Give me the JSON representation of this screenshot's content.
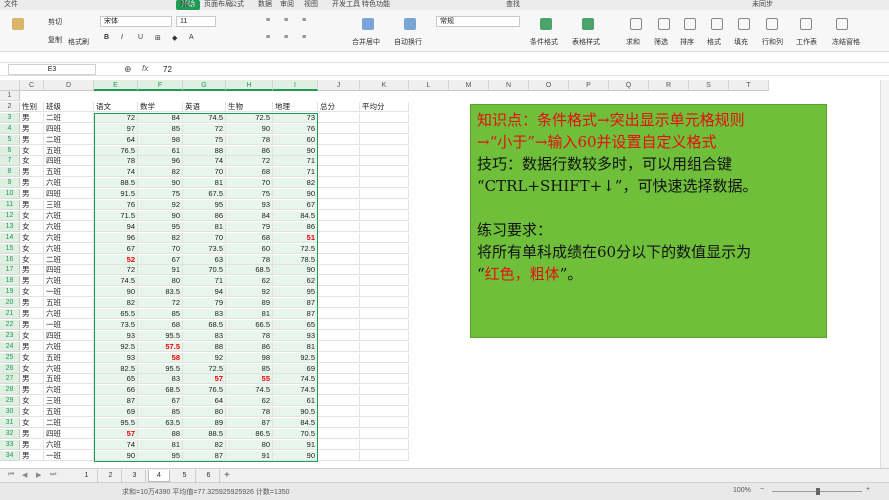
{
  "menu": {
    "items": [
      "文件",
      "开始",
      "插入",
      "页面布局",
      "公式",
      "数据",
      "审阅",
      "视图",
      "开发工具",
      "特色功能"
    ],
    "search_label": "查找",
    "sync_label": "未同步"
  },
  "ribbon": {
    "cut": "剪切",
    "copy": "复制",
    "format_painter": "格式刷",
    "font_name": "宋体",
    "font_size": "11",
    "number_format": "常规",
    "merge": "合并居中",
    "wrap": "自动换行",
    "cond_format": "条件格式",
    "table_style": "表格样式",
    "sum": "求和",
    "filter": "筛选",
    "sort": "排序",
    "format": "格式",
    "fill": "填充",
    "rowcol": "行和列",
    "worksheet": "工作表",
    "freeze": "冻结窗格"
  },
  "formula": {
    "cell_ref": "E3",
    "fx": "fx",
    "value": "72"
  },
  "columns": [
    "C",
    "D",
    "E",
    "F",
    "G",
    "H",
    "I",
    "J",
    "K",
    "L",
    "M",
    "N",
    "O",
    "P",
    "Q",
    "R",
    "S",
    "T"
  ],
  "rows": [
    "1",
    "2",
    "3",
    "4",
    "5",
    "6",
    "7",
    "8",
    "9",
    "10",
    "11",
    "12",
    "13",
    "14",
    "15",
    "16",
    "17",
    "18",
    "19",
    "20",
    "21",
    "22",
    "23",
    "24",
    "25",
    "26",
    "27",
    "28",
    "29",
    "30",
    "31",
    "32",
    "33",
    "34"
  ],
  "headers": [
    "性别",
    "班级",
    "语文",
    "数学",
    "英语",
    "生物",
    "地理",
    "总分",
    "平均分"
  ],
  "records": [
    [
      "男",
      "二班",
      "72",
      "84",
      "74.5",
      "72.5",
      "73"
    ],
    [
      "男",
      "四班",
      "97",
      "85",
      "72",
      "90",
      "76"
    ],
    [
      "男",
      "二班",
      "64",
      "98",
      "75",
      "78",
      "60"
    ],
    [
      "女",
      "五班",
      "76.5",
      "61",
      "88",
      "86",
      "90"
    ],
    [
      "女",
      "四班",
      "78",
      "96",
      "74",
      "72",
      "71"
    ],
    [
      "男",
      "五班",
      "74",
      "82",
      "70",
      "68",
      "71"
    ],
    [
      "男",
      "六班",
      "88.5",
      "90",
      "81",
      "70",
      "82"
    ],
    [
      "男",
      "四班",
      "91.5",
      "75",
      "67.5",
      "75",
      "90"
    ],
    [
      "男",
      "三班",
      "76",
      "92",
      "95",
      "93",
      "67"
    ],
    [
      "女",
      "六班",
      "71.5",
      "90",
      "86",
      "84",
      "84.5"
    ],
    [
      "女",
      "六班",
      "94",
      "95",
      "81",
      "79",
      "86"
    ],
    [
      "女",
      "六班",
      "96",
      "82",
      "70",
      "68",
      "51"
    ],
    [
      "女",
      "六班",
      "67",
      "70",
      "73.5",
      "60",
      "72.5"
    ],
    [
      "女",
      "二班",
      "52",
      "67",
      "63",
      "78",
      "78.5"
    ],
    [
      "男",
      "四班",
      "72",
      "91",
      "70.5",
      "68.5",
      "90"
    ],
    [
      "男",
      "六班",
      "74.5",
      "80",
      "71",
      "62",
      "62"
    ],
    [
      "女",
      "一班",
      "90",
      "83.5",
      "94",
      "92",
      "95"
    ],
    [
      "男",
      "五班",
      "82",
      "72",
      "79",
      "89",
      "87"
    ],
    [
      "男",
      "六班",
      "65.5",
      "85",
      "83",
      "81",
      "87"
    ],
    [
      "男",
      "一班",
      "73.5",
      "68",
      "68.5",
      "66.5",
      "65"
    ],
    [
      "女",
      "四班",
      "93",
      "95.5",
      "83",
      "78",
      "93"
    ],
    [
      "男",
      "六班",
      "92.5",
      "57.5",
      "88",
      "86",
      "81"
    ],
    [
      "女",
      "五班",
      "93",
      "58",
      "92",
      "98",
      "92.5"
    ],
    [
      "女",
      "六班",
      "82.5",
      "95.5",
      "72.5",
      "85",
      "69"
    ],
    [
      "男",
      "五班",
      "65",
      "83",
      "57",
      "55",
      "74.5"
    ],
    [
      "男",
      "六班",
      "66",
      "68.5",
      "76.5",
      "74.5",
      "74.5"
    ],
    [
      "女",
      "三班",
      "87",
      "67",
      "64",
      "62",
      "61"
    ],
    [
      "女",
      "五班",
      "69",
      "85",
      "80",
      "78",
      "90.5"
    ],
    [
      "女",
      "二班",
      "95.5",
      "63.5",
      "89",
      "87",
      "84.5"
    ],
    [
      "男",
      "四班",
      "57",
      "88",
      "88.5",
      "86.5",
      "70.5"
    ],
    [
      "男",
      "六班",
      "74",
      "81",
      "82",
      "80",
      "91"
    ],
    [
      "男",
      "一班",
      "90",
      "95",
      "87",
      "91",
      "90"
    ]
  ],
  "note": {
    "line1": "知识点：条件格式→突出显示单元格规则",
    "line2": "→“小于”→输入60并设置自定义格式",
    "line3": "技巧：数据行数较多时，可以用组合键",
    "line4": "“CTRL+SHIFT+↓”，可快速选择数据。",
    "line5": "练习要求：",
    "line6": "将所有单科成绩在60分以下的数值显示为",
    "line7a": "“",
    "line7b": "红色，粗体",
    "line7c": "”。"
  },
  "tabs": [
    "1",
    "2",
    "3",
    "4",
    "5",
    "6"
  ],
  "active_tab": "4",
  "status": {
    "summary": "求和=10万4390 平均值=77.325925925926 计数=1350",
    "zoom": "100%"
  }
}
